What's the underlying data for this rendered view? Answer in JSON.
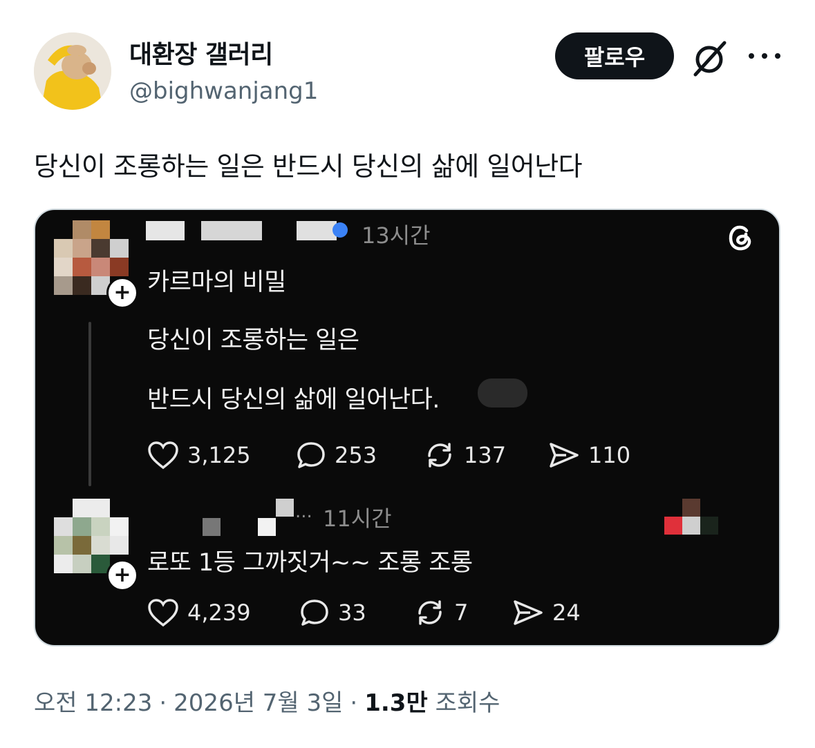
{
  "author": {
    "display_name": "대환장 갤러리",
    "handle": "@bighwanjang1"
  },
  "actions": {
    "follow_label": "팔로우",
    "grok_icon": "slashed-circle-icon",
    "more_icon": "more-dots-icon"
  },
  "tweet": {
    "text": "당신이 조롱하는 일은 반드시 당신의 삶에 일어난다"
  },
  "embed": {
    "logo_icon": "threads-logo-icon",
    "post1": {
      "time": "13시간",
      "line1": "카르마의 비밀",
      "line2": "당신이 조롱하는 일은",
      "line3": "반드시 당신의 삶에 일어난다.",
      "likes": "3,125",
      "comments": "253",
      "reposts": "137",
      "shares": "110"
    },
    "post2": {
      "time": "11시간",
      "text": "로또 1등 그까짓거~~ 조롱 조롱",
      "likes": "4,239",
      "comments": "33",
      "reposts": "7",
      "shares": "24"
    }
  },
  "footer": {
    "time": "오전 12:23",
    "sep1": "·",
    "date": "2026년 7월 3일",
    "sep2": "·",
    "views_count": "1.3만",
    "views_label": "조회수"
  }
}
